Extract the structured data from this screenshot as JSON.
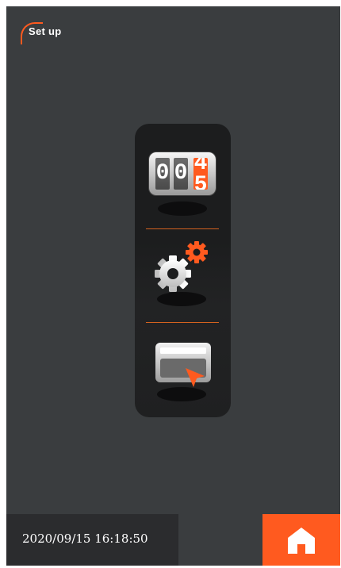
{
  "header": {
    "title": "Set up"
  },
  "menu": {
    "counter": {
      "digits": [
        "0",
        "0"
      ],
      "rolling_digits": [
        "4",
        "5"
      ]
    },
    "items": [
      {
        "icon": "counter-icon"
      },
      {
        "icon": "gears-icon"
      },
      {
        "icon": "card-touch-icon"
      }
    ]
  },
  "footer": {
    "datetime": "2020/09/15 16:18:50",
    "home_icon": "home-icon"
  },
  "colors": {
    "accent": "#ff5a1f",
    "background": "#3a3d3f",
    "panel": "#1c1d1e",
    "footer": "#2b2c2e"
  }
}
